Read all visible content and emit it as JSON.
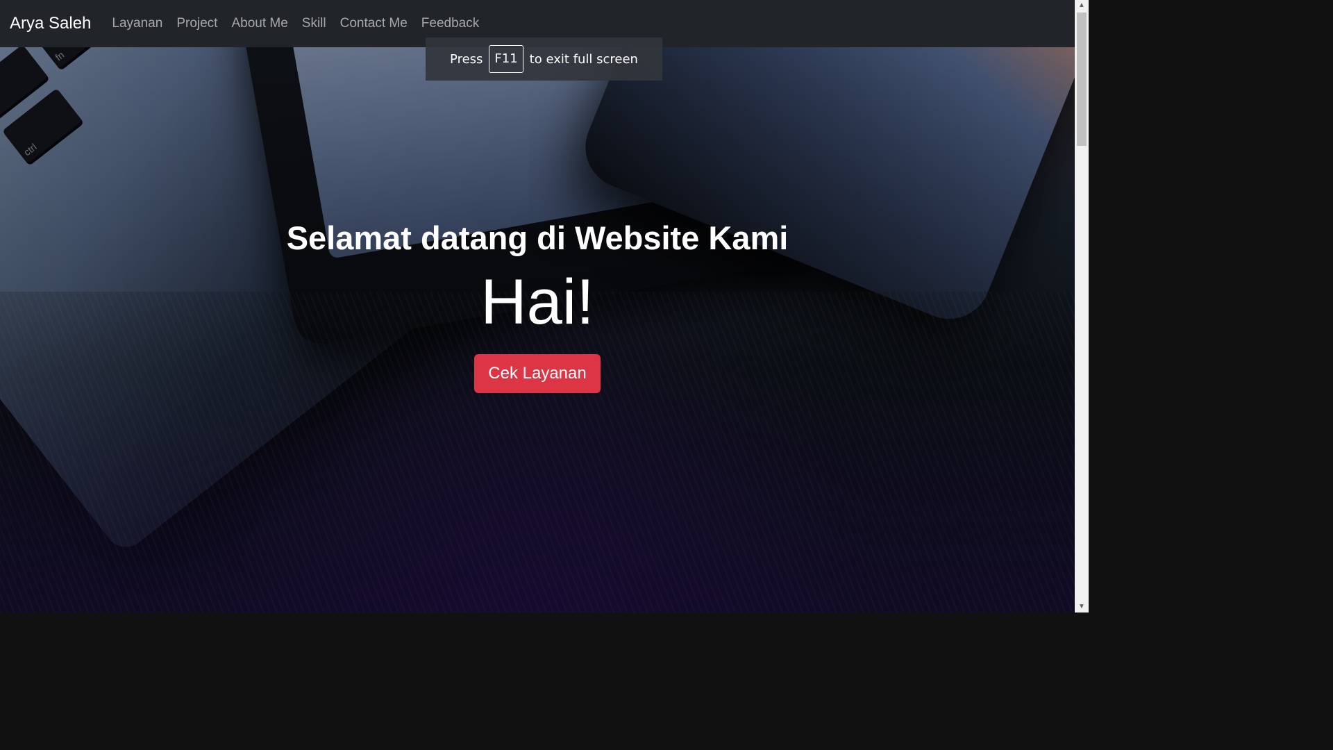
{
  "navbar": {
    "brand": "Arya Saleh",
    "links": [
      "Layanan",
      "Project",
      "About Me",
      "Skill",
      "Contact Me",
      "Feedback"
    ],
    "background": "#212529"
  },
  "fullscreen_hint": {
    "press": "Press",
    "key": "F11",
    "suffix": "to exit full screen"
  },
  "hero": {
    "subtitle": "Selamat datang di Website Kami",
    "title": "Hai!",
    "button_label": "Cek Layanan",
    "button_color": "#dc3545"
  },
  "background_keys": [
    "fn",
    "ctrl"
  ],
  "scrollbar": {
    "up_icon": "chevron-up-icon",
    "down_icon": "chevron-down-icon"
  }
}
